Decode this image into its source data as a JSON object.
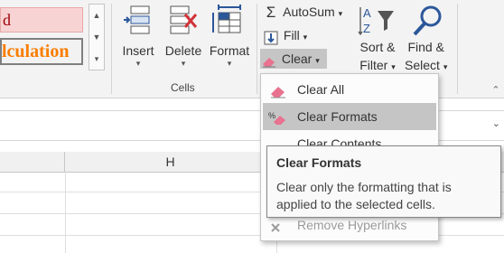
{
  "styles": {
    "bad_cell_text": "d",
    "calculation_text": "lculation"
  },
  "cells_group": {
    "label": "Cells",
    "insert": "Insert",
    "delete": "Delete",
    "format": "Format"
  },
  "editing": {
    "autosum": "AutoSum",
    "fill": "Fill",
    "clear": "Clear",
    "sort_line1": "Sort &",
    "sort_line2": "Filter",
    "find_line1": "Find &",
    "find_line2": "Select"
  },
  "column_header": "H",
  "clear_menu": {
    "items": [
      {
        "label": "Clear All",
        "icon": "eraser-icon"
      },
      {
        "label": "Clear Formats",
        "icon": "clear-formats-icon"
      },
      {
        "label": "Clear Contents",
        "icon": "clear-contents-icon"
      },
      {
        "label": "Remove Hyperlinks",
        "icon": "remove-hyperlink-icon"
      }
    ]
  },
  "tooltip": {
    "title": "Clear Formats",
    "body": "Clear only the formatting that is applied to the selected cells."
  },
  "colors": {
    "ribbon_bg": "#f3f3f3",
    "highlight": "#c5c5c5",
    "eraser_pink": "#e8728f",
    "icon_blue": "#2b579a",
    "delete_red": "#d13438"
  }
}
